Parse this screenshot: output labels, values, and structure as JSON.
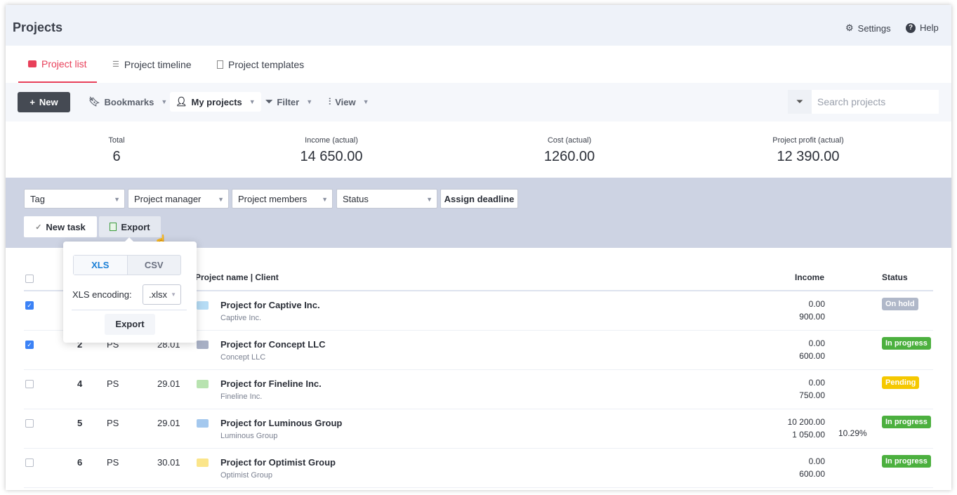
{
  "header": {
    "title": "Projects",
    "settings": "Settings",
    "help": "Help"
  },
  "tabs": [
    {
      "label": "Project list",
      "active": true
    },
    {
      "label": "Project timeline"
    },
    {
      "label": "Project templates"
    }
  ],
  "toolbar": {
    "new": "New",
    "bookmarks": "Bookmarks",
    "my_projects": "My projects",
    "filter": "Filter",
    "view": "View",
    "search_placeholder": "Search projects"
  },
  "stats": [
    {
      "label": "Total",
      "value": "6"
    },
    {
      "label": "Income (actual)",
      "value": "14 650.00"
    },
    {
      "label": "Cost (actual)",
      "value": "1260.00"
    },
    {
      "label": "Project profit (actual)",
      "value": "12 390.00"
    }
  ],
  "filters": {
    "tag": "Tag",
    "manager": "Project manager",
    "members": "Project members",
    "status": "Status",
    "assign_deadline": "Assign deadline",
    "new_task": "New task",
    "export": "Export"
  },
  "export_popup": {
    "xls": "XLS",
    "csv": "CSV",
    "encoding_label": "XLS encoding:",
    "encoding_value": ".xlsx",
    "export": "Export"
  },
  "table": {
    "headers": {
      "name": "Project name | Client",
      "income": "Income",
      "status": "Status"
    },
    "rows": [
      {
        "checked": true,
        "id": "",
        "pm": "",
        "date": "",
        "name": "Project for Captive Inc.",
        "client": "Captive Inc.",
        "income": "0.00",
        "cost": "900.00",
        "pct": "",
        "status": "On hold",
        "status_color": "#b0b8c9",
        "bag": "#b6dcf5"
      },
      {
        "checked": true,
        "id": "2",
        "pm": "PS",
        "date": "28.01",
        "name": "Project for Concept LLC",
        "client": "Concept LLC",
        "income": "0.00",
        "cost": "600.00",
        "pct": "",
        "status": "In progress",
        "status_color": "#4cb03f",
        "bag": "#a7afc4"
      },
      {
        "checked": false,
        "id": "4",
        "pm": "PS",
        "date": "29.01",
        "name": "Project for Fineline Inc.",
        "client": "Fineline Inc.",
        "income": "0.00",
        "cost": "750.00",
        "pct": "",
        "status": "Pending",
        "status_color": "#f5c800",
        "bag": "#b8e3b0"
      },
      {
        "checked": false,
        "id": "5",
        "pm": "PS",
        "date": "29.01",
        "name": "Project for Luminous Group",
        "client": "Luminous Group",
        "income": "10 200.00",
        "cost": "1 050.00",
        "pct": "10.29%",
        "status": "In progress",
        "status_color": "#4cb03f",
        "bag": "#a4c8ee"
      },
      {
        "checked": false,
        "id": "6",
        "pm": "PS",
        "date": "30.01",
        "name": "Project for Optimist Group",
        "client": "Optimist Group",
        "income": "0.00",
        "cost": "600.00",
        "pct": "",
        "status": "In progress",
        "status_color": "#4cb03f",
        "bag": "#fbe58a"
      }
    ]
  }
}
